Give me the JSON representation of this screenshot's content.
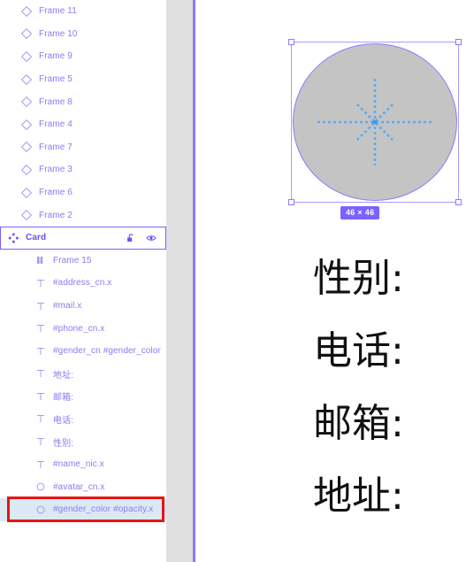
{
  "panel": {
    "name": "layers-panel",
    "accent_color": "#7b61ff",
    "selected_row_fill": "#dce9f5",
    "layers": [
      {
        "label": "Frame 11",
        "icon": "frame-diamond-icon",
        "depth": 1,
        "type": "frame",
        "state": "normal"
      },
      {
        "label": "Frame 10",
        "icon": "frame-diamond-icon",
        "depth": 1,
        "type": "frame",
        "state": "normal"
      },
      {
        "label": "Frame 9",
        "icon": "frame-diamond-icon",
        "depth": 1,
        "type": "frame",
        "state": "normal"
      },
      {
        "label": "Frame 5",
        "icon": "frame-diamond-icon",
        "depth": 1,
        "type": "frame",
        "state": "normal"
      },
      {
        "label": "Frame 8",
        "icon": "frame-diamond-icon",
        "depth": 1,
        "type": "frame",
        "state": "normal"
      },
      {
        "label": "Frame 4",
        "icon": "frame-diamond-icon",
        "depth": 1,
        "type": "frame",
        "state": "normal"
      },
      {
        "label": "Frame 7",
        "icon": "frame-diamond-icon",
        "depth": 1,
        "type": "frame",
        "state": "normal"
      },
      {
        "label": "Frame 3",
        "icon": "frame-diamond-icon",
        "depth": 1,
        "type": "frame",
        "state": "normal"
      },
      {
        "label": "Frame 6",
        "icon": "frame-diamond-icon",
        "depth": 1,
        "type": "frame",
        "state": "normal"
      },
      {
        "label": "Frame 2",
        "icon": "frame-diamond-icon",
        "depth": 1,
        "type": "frame",
        "state": "normal"
      },
      {
        "label": "Card",
        "icon": "component-icon",
        "depth": 0,
        "type": "component",
        "state": "selected-outline",
        "actions": [
          {
            "label": "unlock-icon",
            "name": "unlock-toggle"
          },
          {
            "label": "eye-icon",
            "name": "visibility-toggle"
          }
        ]
      },
      {
        "label": "Frame 15",
        "icon": "frame-columns-icon",
        "depth": 2,
        "type": "frame",
        "state": "normal"
      },
      {
        "label": "#address_cn.x",
        "icon": "text-icon",
        "depth": 2,
        "type": "text",
        "state": "normal"
      },
      {
        "label": "#mail.x",
        "icon": "text-icon",
        "depth": 2,
        "type": "text",
        "state": "normal"
      },
      {
        "label": "#phone_cn.x",
        "icon": "text-icon",
        "depth": 2,
        "type": "text",
        "state": "normal"
      },
      {
        "label": "#gender_cn #gender_color",
        "icon": "text-icon",
        "depth": 2,
        "type": "text",
        "state": "normal"
      },
      {
        "label": "地址:",
        "icon": "text-icon",
        "depth": 2,
        "type": "text",
        "state": "normal"
      },
      {
        "label": "邮箱:",
        "icon": "text-icon",
        "depth": 2,
        "type": "text",
        "state": "normal"
      },
      {
        "label": "电话:",
        "icon": "text-icon",
        "depth": 2,
        "type": "text",
        "state": "normal"
      },
      {
        "label": "性别:",
        "icon": "text-icon",
        "depth": 2,
        "type": "text",
        "state": "normal"
      },
      {
        "label": "#name_nic.x",
        "icon": "text-icon",
        "depth": 2,
        "type": "text",
        "state": "normal"
      },
      {
        "label": "#avatar_cn.x",
        "icon": "ellipse-icon",
        "depth": 2,
        "type": "ellipse",
        "state": "normal"
      },
      {
        "label": "#gender_color  #opacity.x",
        "icon": "ellipse-icon",
        "depth": 2,
        "type": "ellipse",
        "state": "selected-fill"
      }
    ]
  },
  "canvas": {
    "name": "design-canvas",
    "background": "#ffffff",
    "selection": {
      "size_badge": "46 × 46",
      "badge_color": "#7b61ff",
      "handle_count": 4,
      "stroke_color": "#8b7bff"
    },
    "shape": {
      "name": "ellipse",
      "fill": "#c4c4c4",
      "stroke": "#8b7bff"
    },
    "guide": {
      "name": "crosshair-guide",
      "color": "#5aaaf0",
      "style": "dashed"
    },
    "labels": [
      {
        "text": "性别:"
      },
      {
        "text": "电话:"
      },
      {
        "text": "邮箱:"
      },
      {
        "text": "地址:"
      }
    ]
  },
  "annotation": {
    "name": "red-highlight-box",
    "color": "#e81313",
    "targets_layer": "#gender_color  #opacity.x"
  }
}
